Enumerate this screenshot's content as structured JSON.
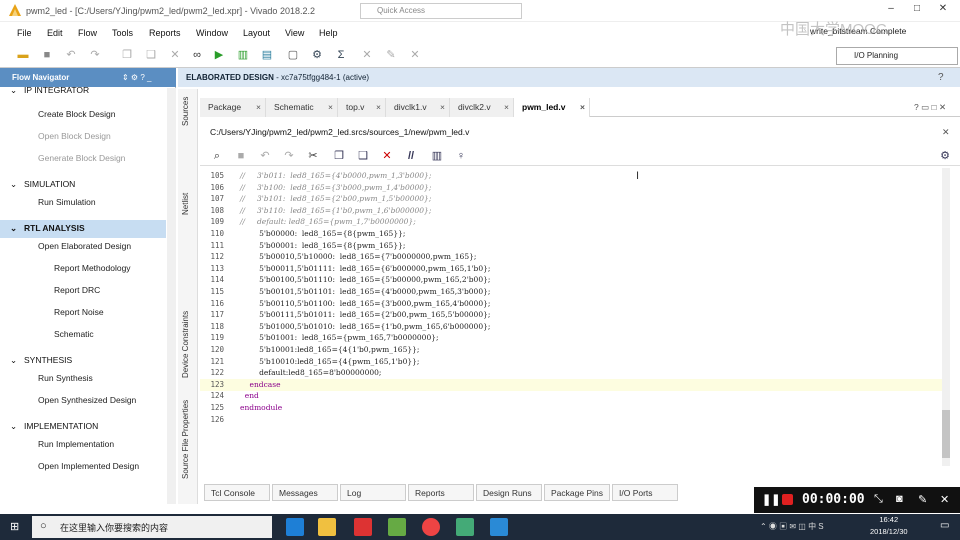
{
  "window": {
    "title": "pwm2_led - [C:/Users/YJing/pwm2_led/pwm2_led.xpr] - Vivado 2018.2.2",
    "quick_access": "Quick Access",
    "status": "write_bitstream Complete",
    "watermark": "中国大学MOOC"
  },
  "menu": [
    "File",
    "Edit",
    "Flow",
    "Tools",
    "Reports",
    "Window",
    "Layout",
    "View",
    "Help"
  ],
  "layout_select": "I/O Planning",
  "flow_nav": {
    "title": "Flow Navigator",
    "items": [
      {
        "label": "IP INTEGRATOR",
        "type": "section"
      },
      {
        "label": "Create Block Design",
        "type": "item"
      },
      {
        "label": "Open Block Design",
        "type": "disabled"
      },
      {
        "label": "Generate Block Design",
        "type": "disabled"
      },
      {
        "label": "SIMULATION",
        "type": "section"
      },
      {
        "label": "Run Simulation",
        "type": "item"
      },
      {
        "label": "RTL ANALYSIS",
        "type": "section"
      },
      {
        "label": "Open Elaborated Design",
        "type": "item"
      },
      {
        "label": "Report Methodology",
        "type": "sub"
      },
      {
        "label": "Report DRC",
        "type": "sub"
      },
      {
        "label": "Report Noise",
        "type": "sub"
      },
      {
        "label": "Schematic",
        "type": "sub"
      },
      {
        "label": "SYNTHESIS",
        "type": "section"
      },
      {
        "label": "Run Synthesis",
        "type": "item"
      },
      {
        "label": "Open Synthesized Design",
        "type": "item"
      },
      {
        "label": "IMPLEMENTATION",
        "type": "section"
      },
      {
        "label": "Run Implementation",
        "type": "item"
      },
      {
        "label": "Open Implemented Design",
        "type": "item"
      }
    ]
  },
  "design_header": {
    "label": "ELABORATED DESIGN",
    "part": "- xc7a75tfgg484-1",
    "state": "(active)"
  },
  "side_tabs": [
    "Sources",
    "Netlist",
    "Device Constraints",
    "Source File Properties"
  ],
  "tabs": [
    "Package",
    "Schematic",
    "top.v",
    "divclk1.v",
    "divclk2.v",
    "pwm_led.v"
  ],
  "active_tab": "pwm_led.v",
  "file_path": "C:/Users/YJing/pwm2_led/pwm2_led.srcs/sources_1/new/pwm_led.v",
  "code": [
    {
      "n": "105",
      "t": "//     3'b011:  led8_165={4'b0000,pwm_1,3'b000};",
      "c": "cm"
    },
    {
      "n": "106",
      "t": "//     3'b100:  led8_165={3'b000,pwm_1,4'b0000};",
      "c": "cm"
    },
    {
      "n": "107",
      "t": "//     3'b101:  led8_165={2'b00,pwm_1,5'b00000};",
      "c": "cm"
    },
    {
      "n": "108",
      "t": "//     3'b110:  led8_165={1'b0,pwm_1,6'b000000};",
      "c": "cm"
    },
    {
      "n": "109",
      "t": "//     default: led8_165={pwm_1,7'b0000000};",
      "c": "cm"
    },
    {
      "n": "110",
      "t": "        5'b00000:  led8_165={8{pwm_165}};",
      "c": ""
    },
    {
      "n": "111",
      "t": "        5'b00001:  led8_165={8{pwm_165}};",
      "c": ""
    },
    {
      "n": "112",
      "t": "        5'b00010,5'b10000:  led8_165={7'b0000000,pwm_165};",
      "c": ""
    },
    {
      "n": "113",
      "t": "        5'b00011,5'b01111:  led8_165={6'b000000,pwm_165,1'b0};",
      "c": ""
    },
    {
      "n": "114",
      "t": "        5'b00100,5'b01110:  led8_165={5'b00000,pwm_165,2'b00};",
      "c": ""
    },
    {
      "n": "115",
      "t": "        5'b00101,5'b01101:  led8_165={4'b0000,pwm_165,3'b000};",
      "c": ""
    },
    {
      "n": "116",
      "t": "        5'b00110,5'b01100:  led8_165={3'b000,pwm_165,4'b0000};",
      "c": ""
    },
    {
      "n": "117",
      "t": "        5'b00111,5'b01011:  led8_165={2'b00,pwm_165,5'b00000};",
      "c": ""
    },
    {
      "n": "118",
      "t": "        5'b01000,5'b01010:  led8_165={1'b0,pwm_165,6'b000000};",
      "c": ""
    },
    {
      "n": "119",
      "t": "        5'b01001:  led8_165={pwm_165,7'b0000000};",
      "c": ""
    },
    {
      "n": "120",
      "t": "        5'b10001:led8_165={4{1'b0,pwm_165}};",
      "c": ""
    },
    {
      "n": "121",
      "t": "        5'b10010:led8_165={4{pwm_165,1'b0}};",
      "c": ""
    },
    {
      "n": "122",
      "t": "        default:led8_165=8'b00000000;",
      "c": ""
    },
    {
      "n": "123",
      "t": "    endcase",
      "c": "kw"
    },
    {
      "n": "124",
      "t": "  end",
      "c": "kw"
    },
    {
      "n": "125",
      "t": "endmodule",
      "c": "kw"
    },
    {
      "n": "126",
      "t": "",
      "c": ""
    }
  ],
  "bottom_tabs": [
    "Tcl Console",
    "Messages",
    "Log",
    "Reports",
    "Design Runs",
    "Package Pins",
    "I/O Ports"
  ],
  "recorder": {
    "time": "00:00:00"
  },
  "taskbar": {
    "search_placeholder": "在这里输入你要搜索的内容",
    "time": "16:42",
    "date": "2018/12/30"
  }
}
